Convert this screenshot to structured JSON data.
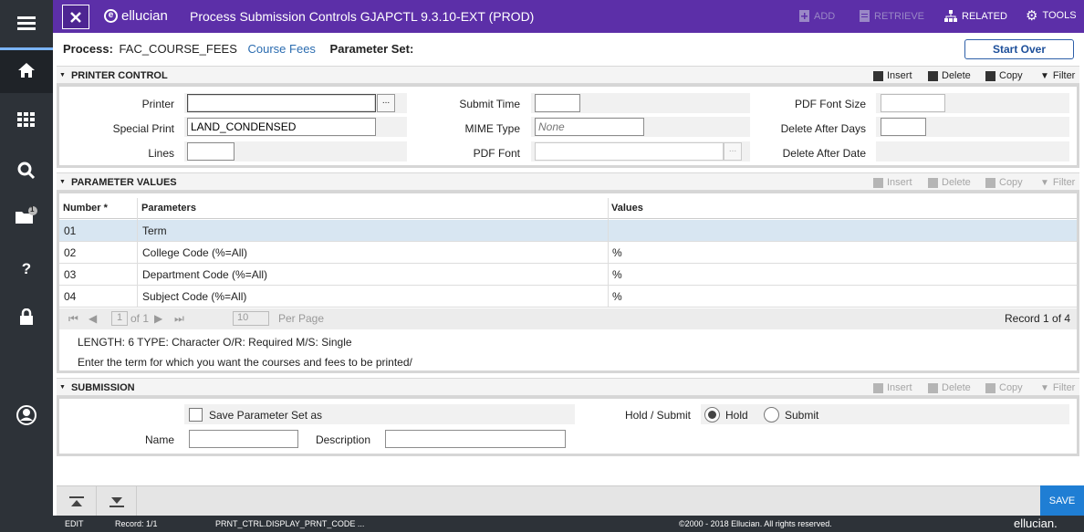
{
  "topbar": {
    "brand": "ellucian",
    "title": "Process Submission Controls GJAPCTL 9.3.10-EXT (PROD)",
    "add": "ADD",
    "retrieve": "RETRIEVE",
    "related": "RELATED",
    "tools": "TOOLS"
  },
  "leftnav": {
    "notification_count": "1"
  },
  "header": {
    "process_label": "Process:",
    "process_value": "FAC_COURSE_FEES",
    "process_desc": "Course Fees",
    "param_set_label": "Parameter Set:",
    "start_over": "Start Over"
  },
  "actions": {
    "insert": "Insert",
    "delete": "Delete",
    "copy": "Copy",
    "filter": "Filter"
  },
  "printer_control": {
    "title": "PRINTER CONTROL",
    "printer_label": "Printer",
    "printer_value": "",
    "special_print_label": "Special Print",
    "special_print_value": "LAND_CONDENSED",
    "lines_label": "Lines",
    "lines_value": "",
    "submit_time_label": "Submit Time",
    "submit_time_value": "",
    "mime_type_label": "MIME Type",
    "mime_type_placeholder": "None",
    "pdf_font_label": "PDF Font",
    "pdf_font_value": "",
    "pdf_font_size_label": "PDF Font Size",
    "pdf_font_size_value": "",
    "delete_after_days_label": "Delete After Days",
    "delete_after_days_value": "",
    "delete_after_date_label": "Delete After Date",
    "lookup_glyph": "..."
  },
  "parameter_values": {
    "title": "PARAMETER VALUES",
    "columns": [
      "Number *",
      "Parameters",
      "Values"
    ],
    "rows": [
      {
        "number": "01",
        "parameter": "Term",
        "value": ""
      },
      {
        "number": "02",
        "parameter": "College Code (%=All)",
        "value": "%"
      },
      {
        "number": "03",
        "parameter": "Department Code (%=All)",
        "value": "%"
      },
      {
        "number": "04",
        "parameter": "Subject Code (%=All)",
        "value": "%"
      }
    ],
    "pager": {
      "page": "1",
      "of": "of 1",
      "per_page_value": "10",
      "per_page_label": "Per Page",
      "record": "Record 1 of 4"
    },
    "help_line1": "LENGTH: 6 TYPE: Character O/R: Required M/S: Single",
    "help_line2": "Enter the term for which you want the courses and fees to be printed/"
  },
  "submission": {
    "title": "SUBMISSION",
    "save_param_label": "Save Parameter Set as",
    "name_label": "Name",
    "description_label": "Description",
    "hold_submit_label": "Hold / Submit",
    "hold_label": "Hold",
    "submit_label": "Submit"
  },
  "footer": {
    "save": "SAVE",
    "mode": "EDIT",
    "record": "Record: 1/1",
    "field": "PRNT_CTRL.DISPLAY_PRNT_CODE ...",
    "copyright": "©2000 - 2018 Ellucian. All rights reserved.",
    "brand": "ellucian."
  }
}
